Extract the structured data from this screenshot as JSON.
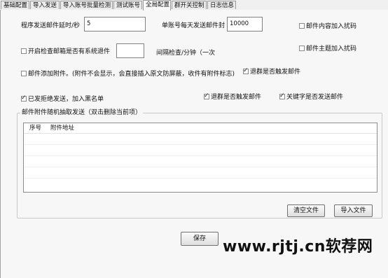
{
  "tabs": [
    {
      "label": "基础配置"
    },
    {
      "label": "导入发送"
    },
    {
      "label": "导入账号批量检测"
    },
    {
      "label": "测试账号"
    },
    {
      "label": "全局配置"
    },
    {
      "label": "群开关控制"
    },
    {
      "label": "日志信息"
    }
  ],
  "settings": {
    "delay_label": "程序发送邮件延时/秒",
    "delay_value": "5",
    "daily_limit_label": "单账号每天发送邮件封",
    "daily_limit_value": "10000",
    "content_captcha_label": "邮件内容加入扰码",
    "check_system_label": "开启检查邮箱是否有系统退件",
    "check_system_value": "",
    "interval_label": "间隔检查/分钟（一次",
    "subject_captcha_label": "邮件主题加入扰码",
    "add_attachment_label": "邮件添加附件。(附件不会显示，会直接插入原文防屏蔽，收件有附件标志)",
    "bounce_trigger_label": "退群是否触发邮件",
    "blacklist_label": "已发拒绝发送，加入黑名单",
    "bounce_trigger2_label": "退群是否触发邮件",
    "keyword_label": "关键字是否发送邮件"
  },
  "attachments": {
    "group_title": "邮件附件随机抽取发送（双击删除当前项）",
    "columns": [
      "序号",
      "附件地址"
    ],
    "rows": [],
    "clear_label": "清空文件",
    "import_label": "导入文件"
  },
  "save_label": "保存",
  "watermark": "www.rjtj.cn软荐网",
  "colors": {
    "panel": "#f7f7f7",
    "tab_active": "#fafafa"
  }
}
